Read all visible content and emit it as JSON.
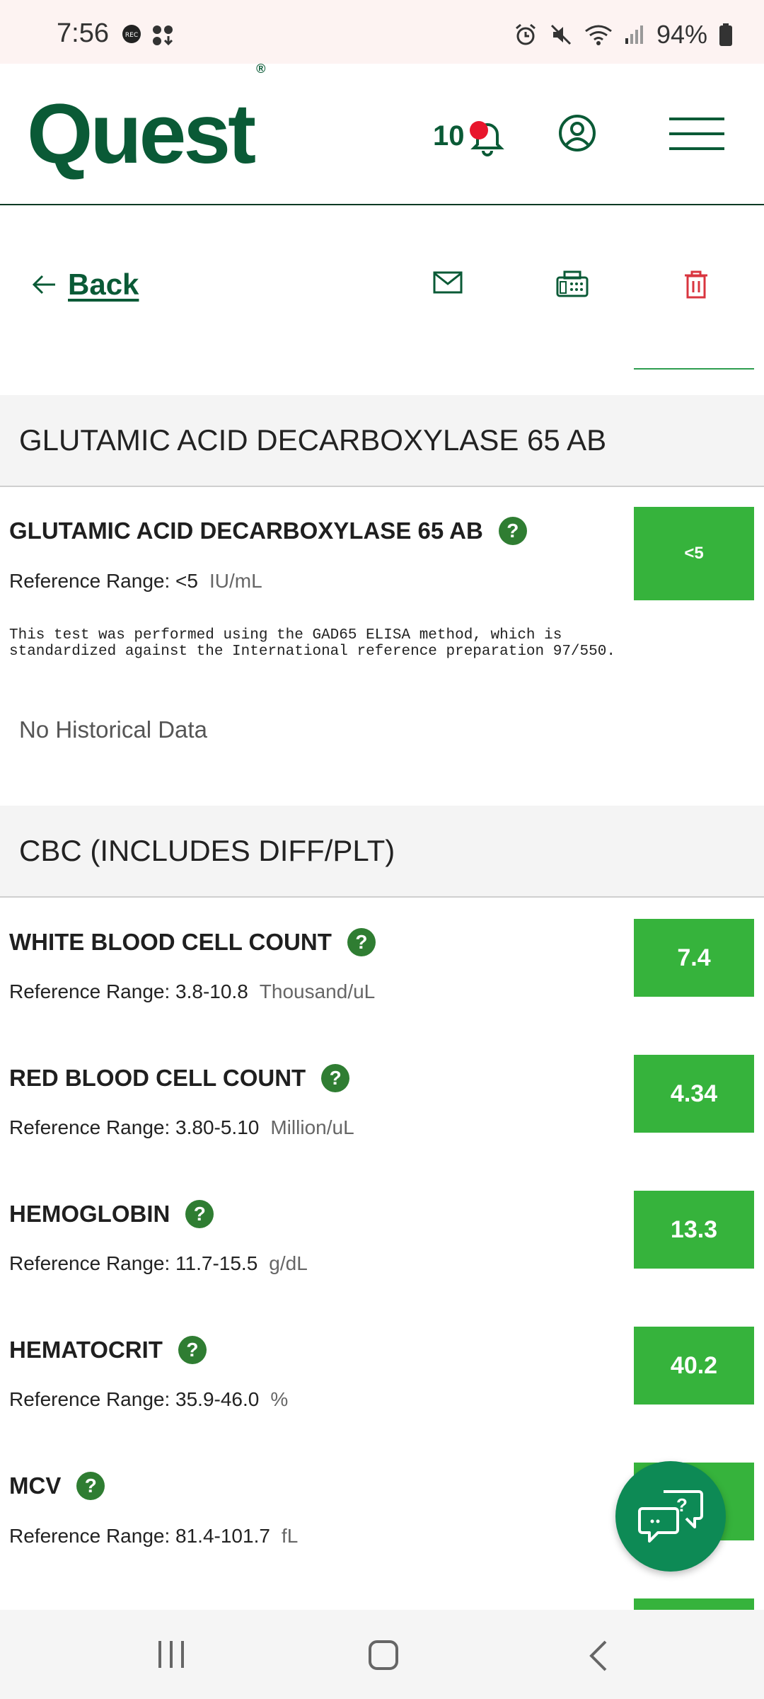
{
  "status_bar": {
    "time": "7:56",
    "battery": "94%",
    "icons_left": [
      "rec-icon",
      "apps-download-icon"
    ],
    "icons_right": [
      "alarm-icon",
      "mute-icon",
      "wifi-icon",
      "signal-icon",
      "battery-icon"
    ]
  },
  "header": {
    "logo_text": "Quest",
    "logo_mark": "®",
    "notification_count": "10",
    "brand_color": "#0a5a36"
  },
  "actions": {
    "back_label": "Back"
  },
  "sections": [
    {
      "title": "GLUTAMIC ACID DECARBOXYLASE 65 AB",
      "tests": [
        {
          "name": "GLUTAMIC ACID DECARBOXYLASE 65 AB",
          "reference": "Reference Range: <5",
          "unit": "IU/mL",
          "value": "<5",
          "note": "This test was performed using the GAD65 ELISA method, which is\nstandardized against the International reference preparation 97/550."
        }
      ],
      "history": "No Historical Data"
    },
    {
      "title": "CBC (INCLUDES DIFF/PLT)",
      "tests": [
        {
          "name": "WHITE BLOOD CELL COUNT",
          "reference": "Reference Range: 3.8-10.8",
          "unit": "Thousand/uL",
          "value": "7.4"
        },
        {
          "name": "RED BLOOD CELL COUNT",
          "reference": "Reference Range: 3.80-5.10",
          "unit": "Million/uL",
          "value": "4.34"
        },
        {
          "name": "HEMOGLOBIN",
          "reference": "Reference Range: 11.7-15.5",
          "unit": "g/dL",
          "value": "13.3"
        },
        {
          "name": "HEMATOCRIT",
          "reference": "Reference Range: 35.9-46.0",
          "unit": "%",
          "value": "40.2"
        },
        {
          "name": "MCV",
          "reference": "Reference Range: 81.4-101.7",
          "unit": "fL",
          "value": ""
        }
      ]
    }
  ],
  "colors": {
    "value_green": "#36b33c",
    "help_green": "#2f7d32",
    "delete_red": "#d9353f",
    "fab_green": "#0d8a55"
  }
}
